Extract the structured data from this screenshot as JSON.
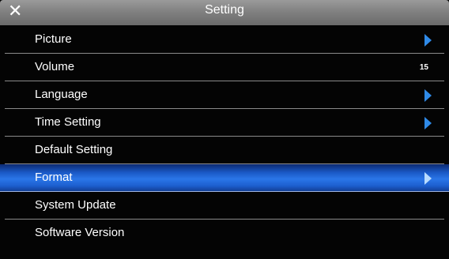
{
  "window": {
    "title": "Setting",
    "close_icon": "close-icon"
  },
  "colors": {
    "titlebar": "#7f7f7f",
    "selected_row": "#2a76e8",
    "arrow": "#2f8ae8",
    "background": "#040404"
  },
  "menu": {
    "items": [
      {
        "label": "Picture",
        "icon": "chevron-right-icon"
      },
      {
        "label": "Volume",
        "value": "15"
      },
      {
        "label": "Language",
        "icon": "chevron-right-icon"
      },
      {
        "label": "Time Setting",
        "icon": "chevron-right-icon"
      },
      {
        "label": "Default Setting"
      },
      {
        "label": "Format",
        "icon": "chevron-right-icon",
        "selected": true
      },
      {
        "label": "System Update"
      },
      {
        "label": "Software Version"
      }
    ]
  }
}
